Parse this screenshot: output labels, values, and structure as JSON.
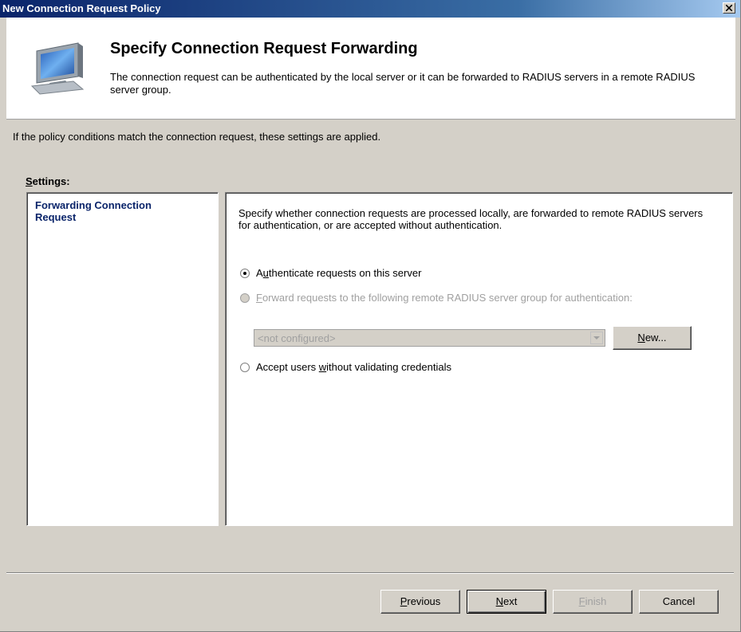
{
  "window": {
    "title": "New Connection Request Policy"
  },
  "header": {
    "title": "Specify Connection Request Forwarding",
    "description": "The connection request can be authenticated by the local server or it can be forwarded to RADIUS servers in a remote RADIUS server group."
  },
  "info_text": "If the policy conditions match the connection request, these settings are applied.",
  "settings": {
    "label_first": "S",
    "label_rest": "ettings:",
    "items": [
      {
        "label": "Forwarding Connection Request"
      }
    ]
  },
  "forwarding": {
    "description": "Specify whether connection requests are processed locally, are forwarded to remote RADIUS servers for authentication, or are accepted without authentication.",
    "options": [
      {
        "pre": "A",
        "key": "u",
        "post": "thenticate requests on this server",
        "selected": true,
        "enabled": true
      },
      {
        "pre": "",
        "key": "F",
        "post": "orward requests to the following remote RADIUS server group for authentication:",
        "selected": false,
        "enabled": false
      },
      {
        "pre": "Accept users ",
        "key": "w",
        "post": "ithout validating credentials",
        "selected": false,
        "enabled": true
      }
    ],
    "server_group": {
      "value": "<not configured>",
      "enabled": false
    },
    "new_button": {
      "key": "N",
      "rest": "ew..."
    }
  },
  "buttons": {
    "previous": {
      "key": "P",
      "rest": "revious"
    },
    "next": {
      "key": "N",
      "rest": "ext"
    },
    "finish": {
      "key": "F",
      "rest": "inish"
    },
    "cancel": {
      "label": "Cancel"
    }
  }
}
